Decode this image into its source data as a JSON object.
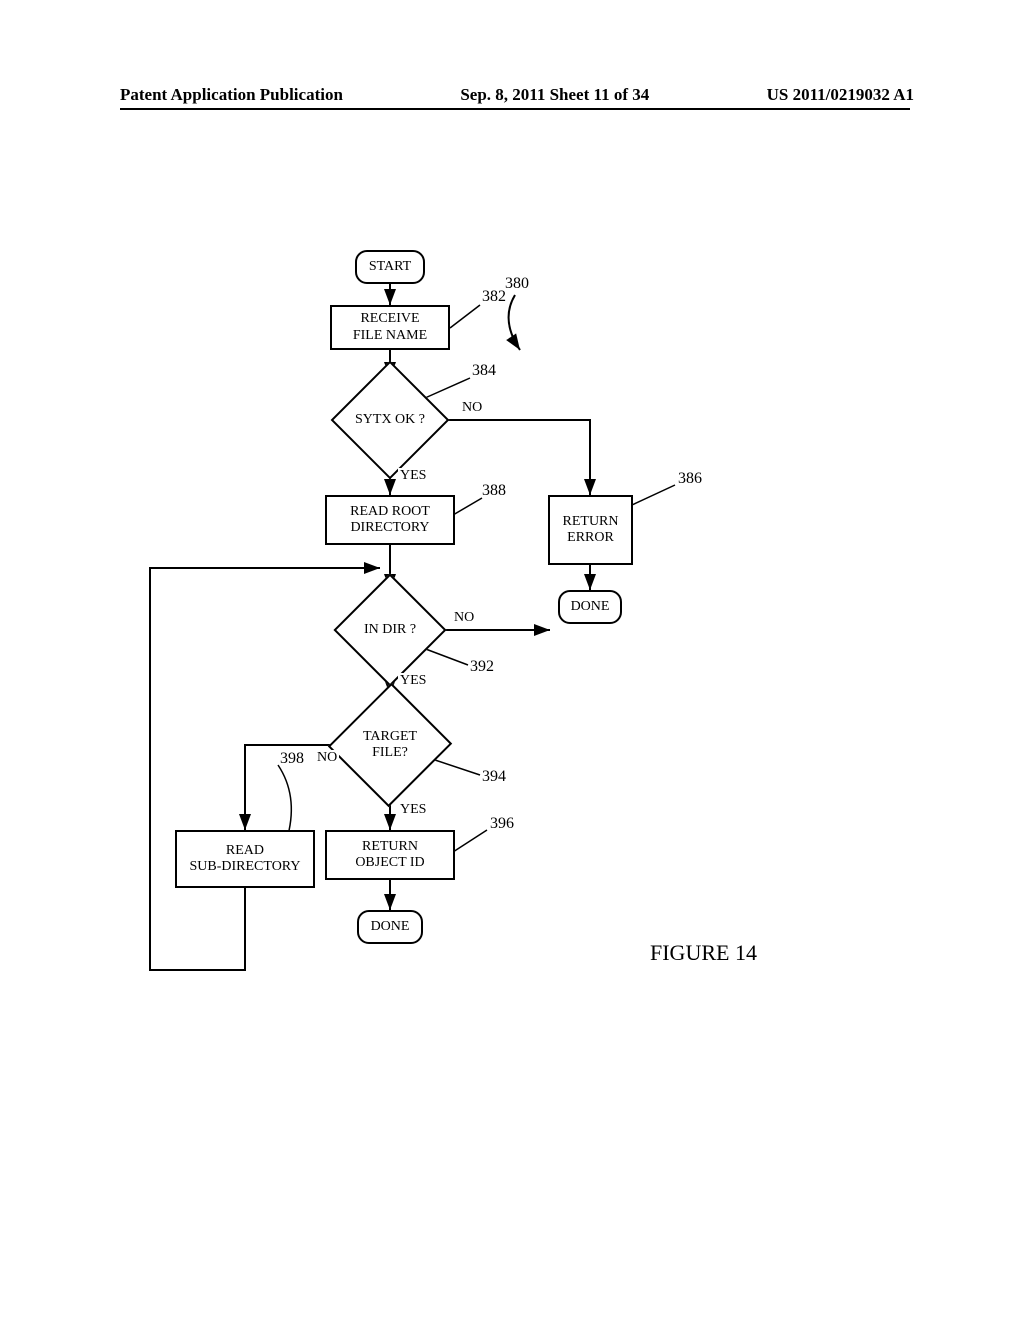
{
  "header": {
    "left": "Patent Application Publication",
    "mid": "Sep. 8, 2011   Sheet 11 of 34",
    "right": "US 2011/0219032 A1"
  },
  "nodes": {
    "start": "START",
    "receive": "RECEIVE\nFILE NAME",
    "syntax": "SYTX OK ?",
    "readroot": "READ ROOT\nDIRECTORY",
    "indir": "IN DIR ?",
    "target": "TARGET\nFILE?",
    "returnid": "RETURN\nOBJECT ID",
    "readsub": "READ\nSUB-DIRECTORY",
    "retErr": "RETURN\nERROR",
    "done1": "DONE",
    "done2": "DONE"
  },
  "refs": {
    "r380": "380",
    "r382": "382",
    "r384": "384",
    "r386": "386",
    "r388": "388",
    "r392": "392",
    "r394": "394",
    "r396": "396",
    "r398": "398"
  },
  "labels": {
    "yes": "YES",
    "no": "NO"
  },
  "caption": "FIGURE 14"
}
